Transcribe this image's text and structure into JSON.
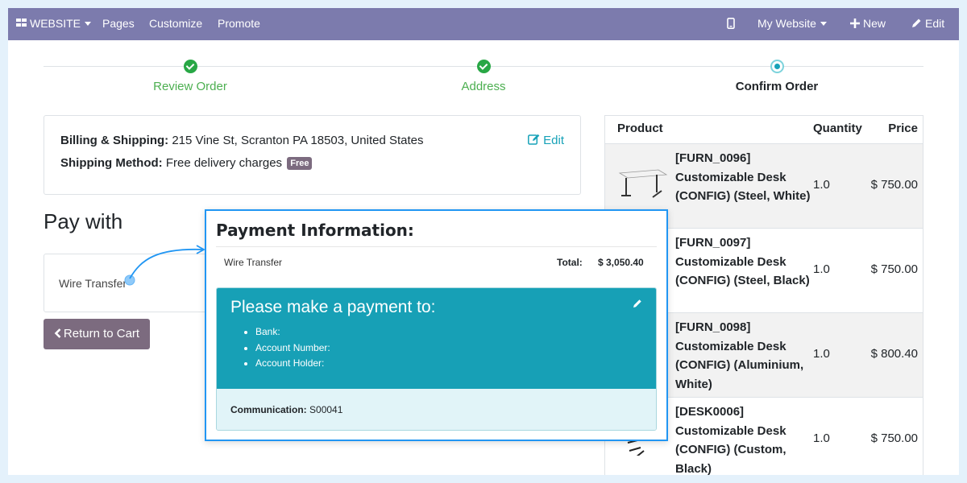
{
  "navbar": {
    "website": "WEBSITE",
    "pages": "Pages",
    "customize": "Customize",
    "promote": "Promote",
    "my_website": "My Website",
    "new": "New",
    "edit": "Edit",
    "icons": [
      "grid-icon",
      "mobile-icon",
      "plus-icon",
      "pencil-icon"
    ],
    "color": "#7c7bad"
  },
  "wizard": {
    "steps": [
      {
        "label": "Review Order",
        "state": "done"
      },
      {
        "label": "Address",
        "state": "done"
      },
      {
        "label": "Confirm Order",
        "state": "current"
      }
    ],
    "done_color": "#28a745"
  },
  "address": {
    "billing_label": "Billing & Shipping:",
    "billing_value": "215 Vine St, Scranton PA 18503, United States",
    "shipping_label": "Shipping Method:",
    "shipping_value": "Free delivery charges",
    "badge": "Free",
    "edit": "Edit"
  },
  "pay_with": {
    "title": "Pay with",
    "method": "Wire Transfer",
    "return_button": "Return to Cart"
  },
  "products": {
    "headers": {
      "product": "Product",
      "quantity": "Quantity",
      "price": "Price"
    },
    "rows": [
      {
        "name": "[FURN_0096] Customizable Desk (CONFIG) (Steel, White)",
        "qty": "1.0",
        "price": "$ 750.00"
      },
      {
        "name": "[FURN_0097] Customizable Desk (CONFIG) (Steel, Black)",
        "qty": "1.0",
        "price": "$ 750.00"
      },
      {
        "name": "[FURN_0098] Customizable Desk (CONFIG) (Aluminium, White)",
        "qty": "1.0",
        "price": "$ 800.40"
      },
      {
        "name": "[DESK0006] Customizable Desk (CONFIG) (Custom, Black)",
        "qty": "1.0",
        "price": "$ 750.00"
      }
    ]
  },
  "popup": {
    "title": "Payment Information:",
    "method": "Wire Transfer",
    "total_label": "Total:",
    "total_value": "$ 3,050.40",
    "pay_title": "Please make a payment to:",
    "items": [
      "Bank:",
      "Account Number:",
      "Account Holder:"
    ],
    "communication_label": "Communication:",
    "communication_value": "S00041",
    "accent": "#17a0b6",
    "border": "#2196f3"
  }
}
